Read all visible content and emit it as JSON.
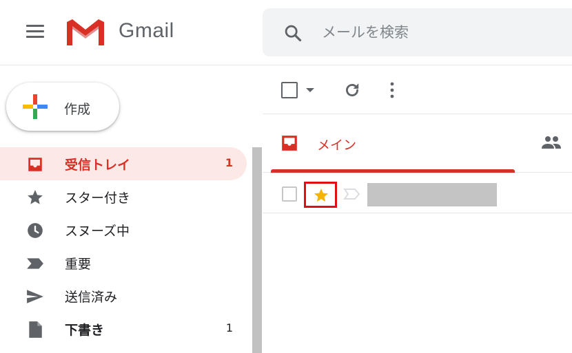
{
  "header": {
    "brand": "Gmail",
    "search_placeholder": "メールを検索"
  },
  "compose": {
    "label": "作成"
  },
  "sidebar": {
    "items": [
      {
        "label": "受信トレイ",
        "count": "1",
        "icon": "inbox-icon",
        "active": true
      },
      {
        "label": "スター付き",
        "count": "",
        "icon": "star-icon"
      },
      {
        "label": "スヌーズ中",
        "count": "",
        "icon": "clock-icon"
      },
      {
        "label": "重要",
        "count": "",
        "icon": "label-important-icon"
      },
      {
        "label": "送信済み",
        "count": "",
        "icon": "send-icon"
      },
      {
        "label": "下書き",
        "count": "1",
        "icon": "draft-icon",
        "bold": true
      }
    ]
  },
  "tabs": {
    "main_label": "メイン"
  },
  "colors": {
    "accent_red": "#d93025",
    "active_bg": "#fce8e6",
    "star_yellow": "#f4b400",
    "highlight_box": "#e01010"
  }
}
